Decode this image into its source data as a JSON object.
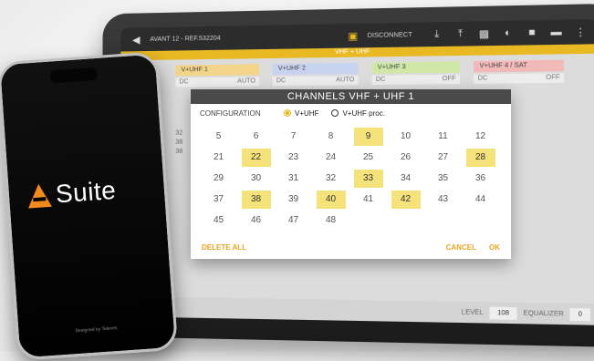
{
  "tablet": {
    "topbar": {
      "ref": "AVANT 12 - REF.532204",
      "disconnect": "DISCONNECT",
      "icons": [
        "back-icon",
        "link-icon",
        "download-icon",
        "upload-icon",
        "bars-icon",
        "gauge-icon",
        "save-icon",
        "folder-icon",
        "more-icon"
      ]
    },
    "subbar": "VHF + UHF",
    "bg_tabs": [
      {
        "label": "V+UHF 1",
        "left": "DC",
        "right": "AUTO",
        "color": "#f3d58a"
      },
      {
        "label": "V+UHF 2",
        "left": "DC",
        "right": "AUTO",
        "color": "#c8d3f0"
      },
      {
        "label": "V+UHF 3",
        "left": "DC",
        "right": "OFF",
        "color": "#cfe8a8"
      },
      {
        "label": "V+UHF 4 / SAT",
        "left": "DC",
        "right": "OFF",
        "color": "#f2b9b9"
      }
    ],
    "bg_list": [
      "32",
      "38",
      "38"
    ],
    "bottom": {
      "level_label": "LEVEL",
      "level_value": "108",
      "eq_label": "EQUALIZER",
      "eq_value": "0"
    }
  },
  "dialog": {
    "title": "CHANNELS  VHF + UHF 1",
    "config_label": "CONFIGURATION",
    "options": [
      {
        "label": "V+UHF",
        "selected": true
      },
      {
        "label": "V+UHF proc.",
        "selected": false
      }
    ],
    "channels": [
      {
        "n": "5",
        "sel": false
      },
      {
        "n": "6",
        "sel": false
      },
      {
        "n": "7",
        "sel": false
      },
      {
        "n": "8",
        "sel": false
      },
      {
        "n": "9",
        "sel": true
      },
      {
        "n": "10",
        "sel": false
      },
      {
        "n": "11",
        "sel": false
      },
      {
        "n": "12",
        "sel": false
      },
      {
        "n": "21",
        "sel": false
      },
      {
        "n": "22",
        "sel": true
      },
      {
        "n": "23",
        "sel": false
      },
      {
        "n": "24",
        "sel": false
      },
      {
        "n": "25",
        "sel": false
      },
      {
        "n": "26",
        "sel": false
      },
      {
        "n": "27",
        "sel": false
      },
      {
        "n": "28",
        "sel": true
      },
      {
        "n": "29",
        "sel": false
      },
      {
        "n": "30",
        "sel": false
      },
      {
        "n": "31",
        "sel": false
      },
      {
        "n": "32",
        "sel": false
      },
      {
        "n": "33",
        "sel": true
      },
      {
        "n": "34",
        "sel": false
      },
      {
        "n": "35",
        "sel": false
      },
      {
        "n": "36",
        "sel": false
      },
      {
        "n": "37",
        "sel": false
      },
      {
        "n": "38",
        "sel": true
      },
      {
        "n": "39",
        "sel": false
      },
      {
        "n": "40",
        "sel": true
      },
      {
        "n": "41",
        "sel": false
      },
      {
        "n": "42",
        "sel": true
      },
      {
        "n": "43",
        "sel": false
      },
      {
        "n": "44",
        "sel": false
      },
      {
        "n": "45",
        "sel": false
      },
      {
        "n": "46",
        "sel": false
      },
      {
        "n": "47",
        "sel": false
      },
      {
        "n": "48",
        "sel": false
      }
    ],
    "actions": {
      "delete_all": "DELETE ALL",
      "cancel": "CANCEL",
      "ok": "OK"
    }
  },
  "phone": {
    "logo_text": "Suite",
    "footer": "Designed by Televes"
  },
  "colors": {
    "accent": "#e8b923",
    "selected_cell": "#f5e27a",
    "logo": "#f08a1c"
  }
}
